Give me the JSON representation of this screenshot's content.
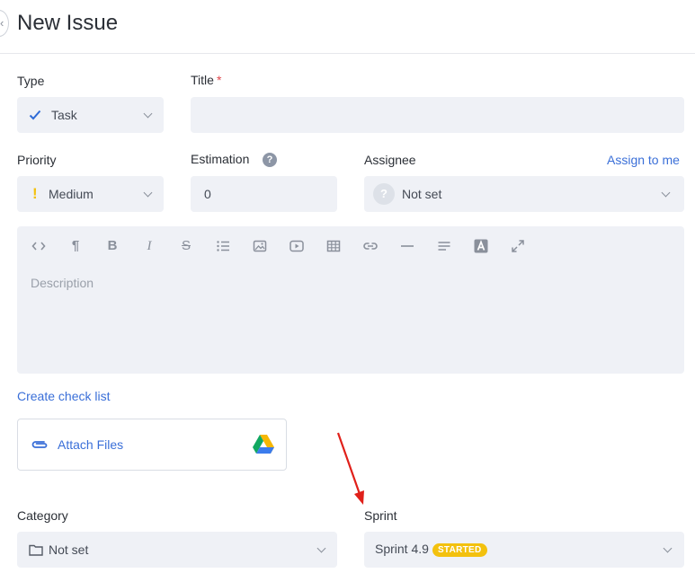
{
  "header": {
    "title": "New Issue"
  },
  "type": {
    "label": "Type",
    "value": "Task"
  },
  "title_field": {
    "label": "Title",
    "required_mark": "*",
    "value": ""
  },
  "priority": {
    "label": "Priority",
    "value": "Medium",
    "color": "#f3c10e"
  },
  "estimation": {
    "label": "Estimation",
    "help": "?",
    "value": "0"
  },
  "assignee": {
    "label": "Assignee",
    "assign_link": "Assign to me",
    "value": "Not set"
  },
  "description": {
    "placeholder": "Description",
    "toolbar": [
      "code-icon",
      "paragraph-icon",
      "bold-icon",
      "italic-icon",
      "strikethrough-icon",
      "bullet-list-icon",
      "image-icon",
      "video-icon",
      "table-icon",
      "link-icon",
      "horizontal-rule-icon",
      "align-icon",
      "text-color-icon",
      "fullscreen-icon"
    ]
  },
  "checklist": {
    "label": "Create check list"
  },
  "attach": {
    "label": "Attach Files"
  },
  "category": {
    "label": "Category",
    "value": "Not set"
  },
  "sprint": {
    "label": "Sprint",
    "value": "Sprint 4.9",
    "badge": "STARTED",
    "badge_color": "#f3c10e"
  },
  "colors": {
    "accent": "#3a6fd8",
    "field_bg": "#eff1f6",
    "arrow": "#e0201a"
  }
}
